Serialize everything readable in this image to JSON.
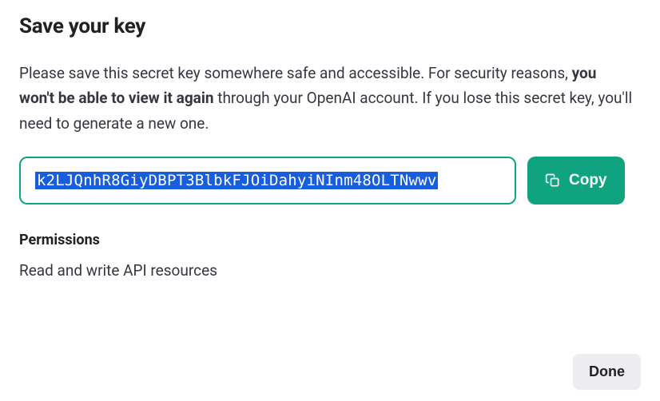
{
  "title": "Save your key",
  "description": {
    "part1": "Please save this secret key somewhere safe and accessible. For security reasons, ",
    "bold": "you won't be able to view it again",
    "part2": " through your OpenAI account. If you lose this secret key, you'll need to generate a new one."
  },
  "key_value": "k2LJQnhR8GiyDBPT3BlbkFJOiDahyiNInm48OLTNwwv",
  "copy_label": "Copy",
  "permissions": {
    "heading": "Permissions",
    "value": "Read and write API resources"
  },
  "done_label": "Done",
  "colors": {
    "accent": "#10a37f",
    "selection": "#175ddc",
    "button_bg": "#ececf1"
  }
}
